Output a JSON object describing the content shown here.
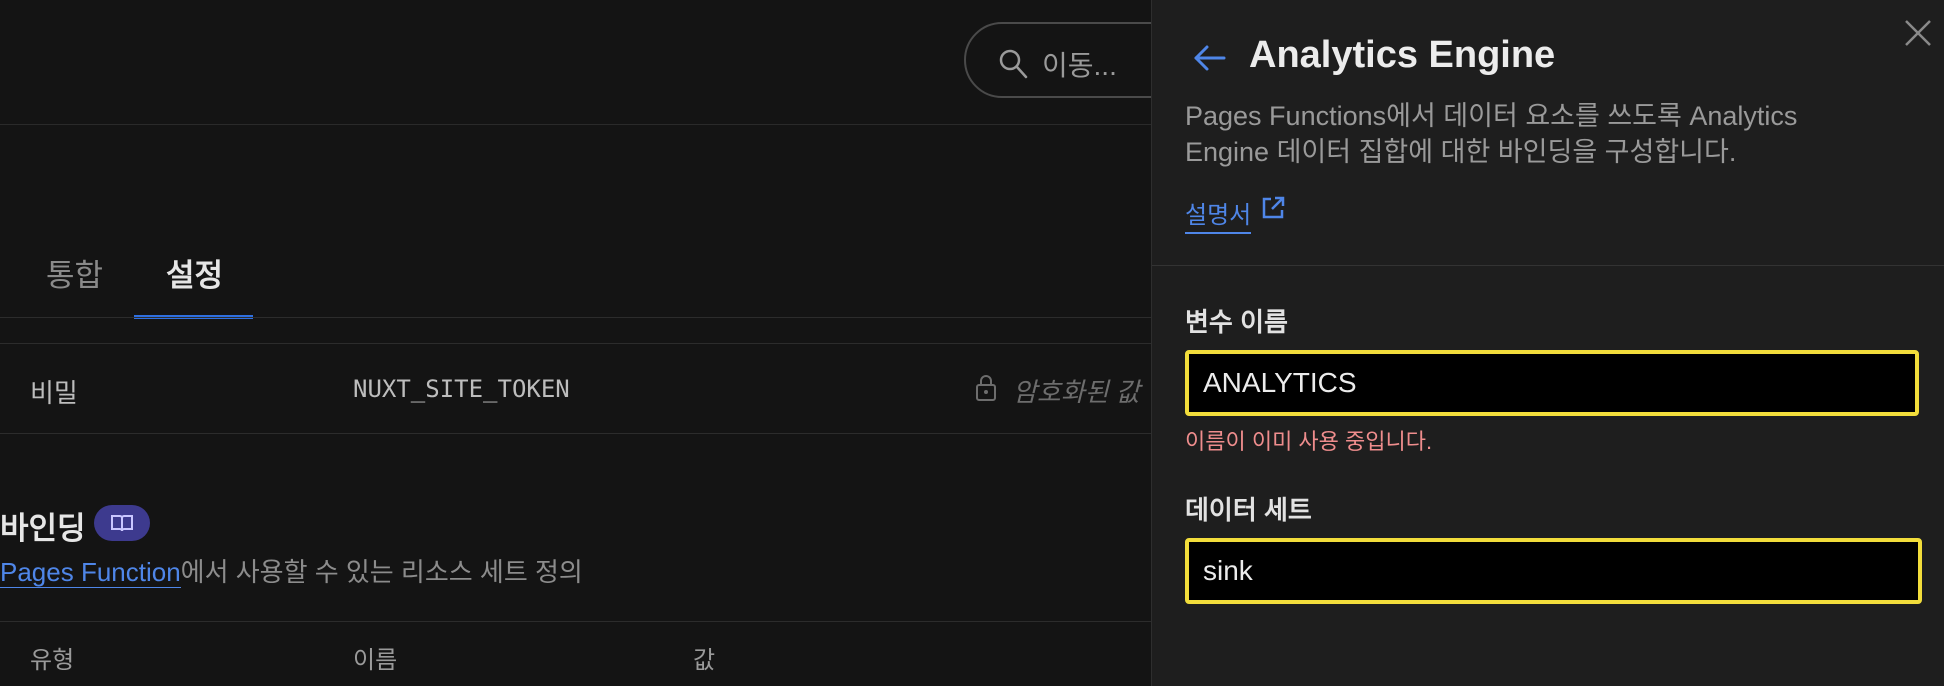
{
  "background": {
    "search": {
      "placeholder": "이동..."
    },
    "tabs": [
      {
        "label": "통합",
        "active": false
      },
      {
        "label": "설정",
        "active": true
      }
    ],
    "secret_row": {
      "type": "비밀",
      "name": "NUXT_SITE_TOKEN",
      "value": "암호화된 값"
    },
    "bindings": {
      "title": "바인딩",
      "desc_link": "Pages Function",
      "desc_rest": "에서 사용할 수 있는 리소스 세트 정의",
      "columns": [
        "유형",
        "이름",
        "값"
      ]
    }
  },
  "panel": {
    "title": "Analytics Engine",
    "description": "Pages Functions에서 데이터 요소를 쓰도록 Analytics Engine 데이터 집합에 대한 바인딩을 구성합니다.",
    "docs_link": "설명서",
    "variable_label": "변수 이름",
    "variable_value": "ANALYTICS",
    "variable_error": "이름이 이미 사용 중입니다.",
    "dataset_label": "데이터 세트",
    "dataset_value": "sink"
  },
  "colors": {
    "accent": "#4f86e8",
    "focus_border": "#f2dd3b",
    "error": "#ef8d8d",
    "badge": "#3d3a8e"
  },
  "icons": [
    "search-icon",
    "lock-icon",
    "book-icon",
    "back-arrow-icon",
    "close-icon",
    "external-link-icon"
  ]
}
